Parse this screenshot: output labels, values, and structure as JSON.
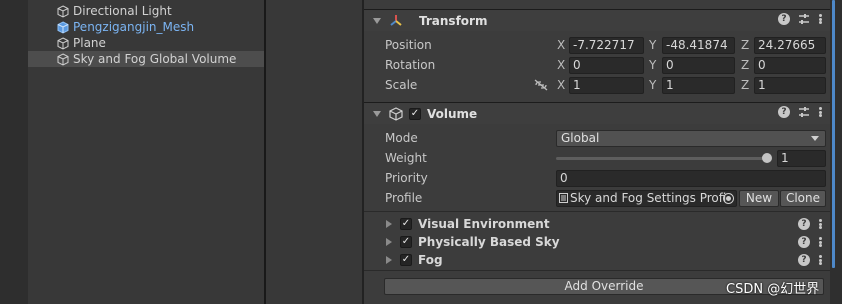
{
  "hierarchy": {
    "items": [
      {
        "label": "Directional Light",
        "prefab": false,
        "selected": false
      },
      {
        "label": "Pengzigangjin_Mesh",
        "prefab": true,
        "selected": false
      },
      {
        "label": "Plane",
        "prefab": false,
        "selected": false
      },
      {
        "label": "Sky and Fog Global Volume",
        "prefab": false,
        "selected": true
      }
    ]
  },
  "transform": {
    "title": "Transform",
    "position": {
      "label": "Position",
      "x": "-7.722717",
      "y": "-48.41874",
      "z": "24.27665"
    },
    "rotation": {
      "label": "Rotation",
      "x": "0",
      "y": "0",
      "z": "0"
    },
    "scale": {
      "label": "Scale",
      "x": "1",
      "y": "1",
      "z": "1"
    },
    "axes": {
      "x": "X",
      "y": "Y",
      "z": "Z"
    }
  },
  "volume": {
    "title": "Volume",
    "enabled": true,
    "mode": {
      "label": "Mode",
      "value": "Global"
    },
    "weight": {
      "label": "Weight",
      "value": "1",
      "fraction": 1.0
    },
    "priority": {
      "label": "Priority",
      "value": "0"
    },
    "profile": {
      "label": "Profile",
      "value": "Sky and Fog Settings Profi",
      "new_label": "New",
      "clone_label": "Clone"
    },
    "overrides": [
      {
        "label": "Visual Environment",
        "enabled": true
      },
      {
        "label": "Physically Based Sky",
        "enabled": true
      },
      {
        "label": "Fog",
        "enabled": true
      }
    ],
    "add_override_label": "Add Override"
  },
  "watermark": "CSDN @幻世界",
  "colors": {
    "accent": "#4e88c8",
    "prefab_text": "#7bb4f2",
    "panel": "#3c3c3c"
  }
}
